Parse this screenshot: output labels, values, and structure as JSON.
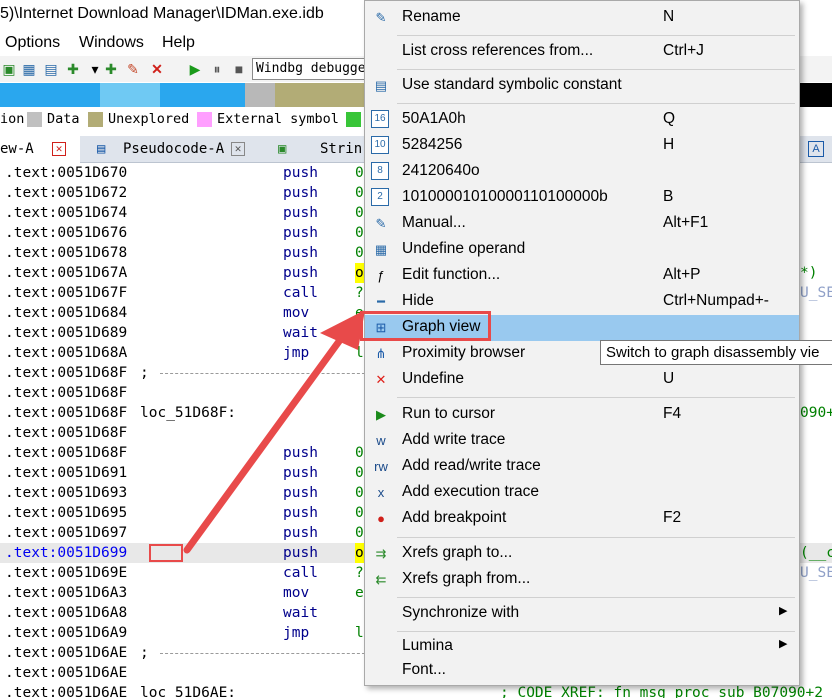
{
  "title_bar": {
    "title": "5)\\Internet Download Manager\\IDMan.exe.idb"
  },
  "menu_bar": {
    "items": [
      "Options",
      "Windows",
      "Help"
    ]
  },
  "toolbar": {
    "debugger": "Windbg debugger"
  },
  "legend": [
    {
      "label": "ion",
      "color": ""
    },
    {
      "label": "Data",
      "color": "#c0c0c0"
    },
    {
      "label": "Unexplored",
      "color": "#b2ac76"
    },
    {
      "label": "External symbol",
      "color": "#ff9fff"
    },
    {
      "label": "",
      "color": "#38c538"
    }
  ],
  "tabs": [
    {
      "label": "ew-A",
      "close": "✕"
    },
    {
      "label": "Pseudocode-A",
      "close": "✕"
    },
    {
      "label": "Strin",
      "close": ""
    }
  ],
  "disasm": {
    "rows": [
      {
        "addr": ".text:0051D670",
        "mnem": "push",
        "oper": "0"
      },
      {
        "addr": ".text:0051D672",
        "mnem": "push",
        "oper": "0"
      },
      {
        "addr": ".text:0051D674",
        "mnem": "push",
        "oper": "0"
      },
      {
        "addr": ".text:0051D676",
        "mnem": "push",
        "oper": "0"
      },
      {
        "addr": ".text:0051D678",
        "mnem": "push",
        "oper": "0"
      },
      {
        "addr": ".text:0051D67A",
        "mnem": "push",
        "oper": "o",
        "yellow": true,
        "right": "*)"
      },
      {
        "addr": ".text:0051D67F",
        "mnem": "call",
        "oper": "?",
        "right": "U_SE"
      },
      {
        "addr": ".text:0051D684",
        "mnem": "mov",
        "oper": "e"
      },
      {
        "addr": ".text:0051D689",
        "mnem": "wait",
        "oper": ""
      },
      {
        "addr": ".text:0051D68A",
        "mnem": "jmp",
        "oper": "l"
      },
      {
        "addr": ".text:0051D68F",
        "sep": ";"
      },
      {
        "addr": ".text:0051D68F"
      },
      {
        "addr": ".text:0051D68F",
        "label": "loc_51D68F:",
        "right": "090+2"
      },
      {
        "addr": ".text:0051D68F"
      },
      {
        "addr": ".text:0051D68F",
        "mnem": "push",
        "oper": "0"
      },
      {
        "addr": ".text:0051D691",
        "mnem": "push",
        "oper": "0"
      },
      {
        "addr": ".text:0051D693",
        "mnem": "push",
        "oper": "0"
      },
      {
        "addr": ".text:0051D695",
        "mnem": "push",
        "oper": "0"
      },
      {
        "addr": ".text:0051D697",
        "mnem": "push",
        "oper": "0"
      },
      {
        "addr": ".text:0051D699",
        "mnem": "push",
        "oper": "o",
        "yellow": true,
        "current": true,
        "right": "(__c"
      },
      {
        "addr": ".text:0051D69E",
        "mnem": "call",
        "oper": "?",
        "right": "U_SE"
      },
      {
        "addr": ".text:0051D6A3",
        "mnem": "mov",
        "oper": "e"
      },
      {
        "addr": ".text:0051D6A8",
        "mnem": "wait",
        "oper": ""
      },
      {
        "addr": ".text:0051D6A9",
        "mnem": "jmp",
        "oper": "l"
      },
      {
        "addr": ".text:0051D6AE",
        "sep": ";"
      },
      {
        "addr": ".text:0051D6AE"
      },
      {
        "addr": ".text:0051D6AE",
        "label": "loc_51D6AE:",
        "comment": "; CODE XREF: fn_msg_proc_sub_B07090+2"
      }
    ]
  },
  "context_menu": {
    "items": [
      {
        "icon": "✎",
        "label": "Rename",
        "shortcut": "N"
      },
      {
        "sep": true
      },
      {
        "icon": "",
        "label": "List cross references from...",
        "shortcut": "Ctrl+J"
      },
      {
        "sep": true
      },
      {
        "icon": "▤",
        "label": "Use standard symbolic constant",
        "shortcut": ""
      },
      {
        "sep": true
      },
      {
        "icon": "16",
        "label": "50A1A0h",
        "shortcut": "Q"
      },
      {
        "icon": "10",
        "label": "5284256",
        "shortcut": "H"
      },
      {
        "icon": "8",
        "label": "24120640o",
        "shortcut": ""
      },
      {
        "icon": "2",
        "label": "10100001010000110100000b",
        "shortcut": "B"
      },
      {
        "icon": "✎",
        "label": "Manual...",
        "shortcut": "Alt+F1"
      },
      {
        "icon": "▦",
        "label": "Undefine operand",
        "shortcut": ""
      },
      {
        "icon": "ƒ",
        "label": "Edit function...",
        "shortcut": "Alt+P"
      },
      {
        "icon": "━",
        "label": "Hide",
        "shortcut": "Ctrl+Numpad+-"
      },
      {
        "icon": "⊞",
        "label": "Graph view",
        "shortcut": "",
        "active": true
      },
      {
        "icon": "⋔",
        "label": "Proximity browser",
        "shortcut": ""
      },
      {
        "icon": "✕",
        "label": "Undefine",
        "shortcut": "U"
      },
      {
        "sep": true
      },
      {
        "icon": "▶",
        "label": "Run to cursor",
        "shortcut": "F4"
      },
      {
        "icon": "w",
        "label": "Add write trace",
        "shortcut": ""
      },
      {
        "icon": "rw",
        "label": "Add read/write trace",
        "shortcut": ""
      },
      {
        "icon": "x",
        "label": "Add execution trace",
        "shortcut": ""
      },
      {
        "icon": "●",
        "label": "Add breakpoint",
        "shortcut": "F2"
      },
      {
        "sep": true
      },
      {
        "icon": "⇉",
        "label": "Xrefs graph to...",
        "shortcut": ""
      },
      {
        "icon": "⇇",
        "label": "Xrefs graph from...",
        "shortcut": ""
      },
      {
        "sep": true
      },
      {
        "icon": "",
        "label": "Synchronize with",
        "shortcut": "",
        "submenu": "▶"
      },
      {
        "sep": true
      },
      {
        "icon": "",
        "label": "Lumina",
        "shortcut": "",
        "submenu": "▶"
      },
      {
        "icon": "",
        "label": "Font...",
        "shortcut": ""
      }
    ]
  },
  "tooltip": {
    "text": "Switch to graph disassembly vie"
  },
  "colors": {
    "menu_bg": "#f2f2f2",
    "menu_active": "#99c9ef",
    "annotation_red": "#e84a4a",
    "code_mnemonic": "#00008b",
    "code_operand": "#008000"
  }
}
